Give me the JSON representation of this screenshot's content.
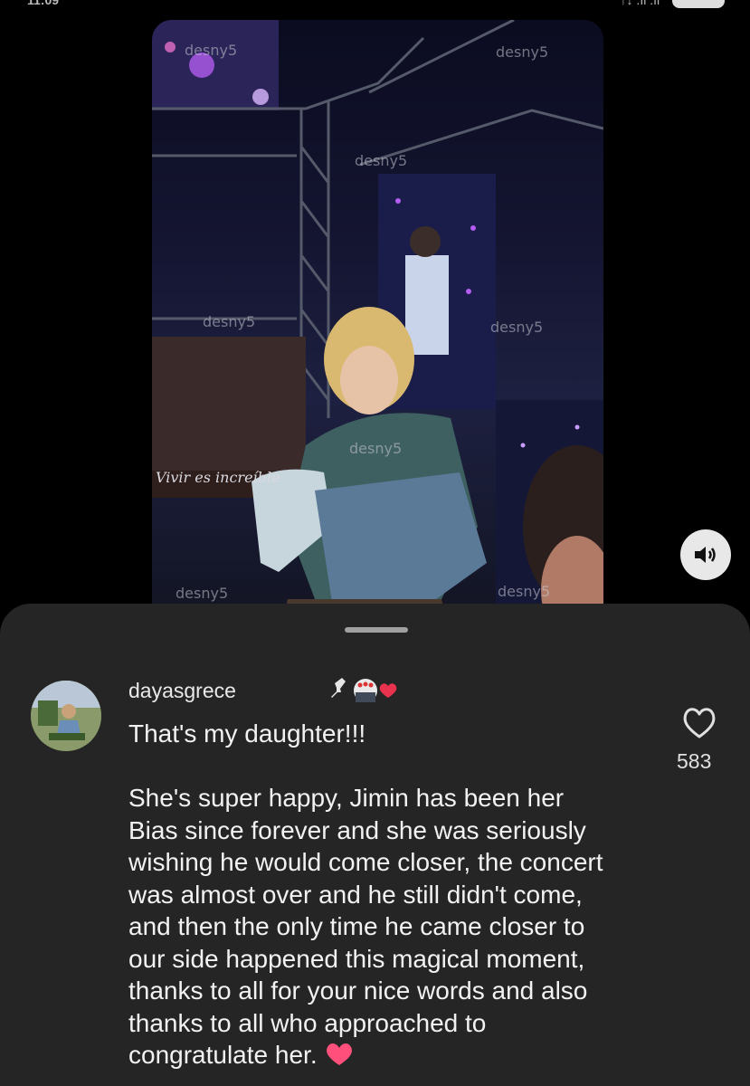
{
  "status_bar": {
    "time": "11:09",
    "signal": "↑↓ .ıl .ıl"
  },
  "video": {
    "watermark": "desny5",
    "sign_text": "Vivir es increíble"
  },
  "comment": {
    "username": "dayasgrece",
    "text": "That's my daughter!!!\n\nShe's super happy, Jimin has been her\nBias since forever and she was seriously\nwishing he would come closer, the concert\nwas almost over and he still didn't come,\nand then the only time he came closer to\nour side happened this magical moment,\nthanks to all for your nice words and also\nthanks to all who approached to\ncongratulate her. ",
    "like_count": "583"
  },
  "colors": {
    "sheet_bg": "#252525",
    "text": "#f2f2f2",
    "heart": "#e8324e"
  },
  "icons": {
    "sound": "speaker-volume-icon",
    "like": "heart-outline-icon",
    "pin": "pin-icon",
    "creator_heart": "red-heart-icon"
  }
}
